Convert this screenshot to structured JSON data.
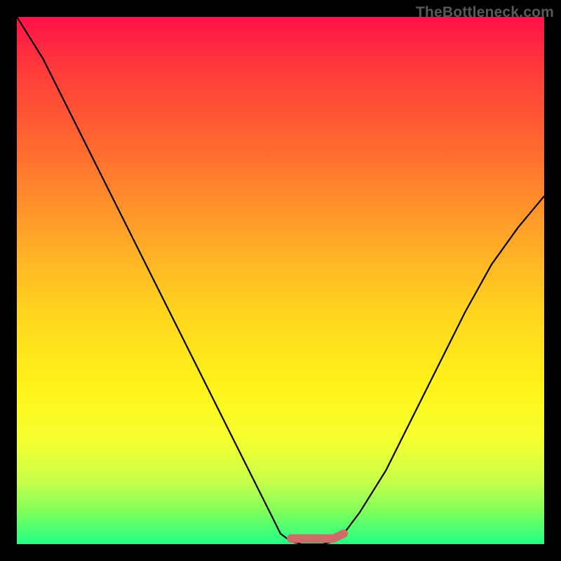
{
  "watermark": "TheBottleneck.com",
  "chart_data": {
    "type": "line",
    "title": "",
    "xlabel": "",
    "ylabel": "",
    "xlim": [
      0,
      100
    ],
    "ylim": [
      0,
      100
    ],
    "grid": false,
    "series": [
      {
        "name": "curve",
        "x": [
          0,
          5,
          10,
          15,
          20,
          25,
          30,
          35,
          40,
          45,
          48,
          50,
          52,
          54,
          56,
          58,
          60,
          62,
          65,
          70,
          75,
          80,
          85,
          90,
          95,
          100
        ],
        "y": [
          100,
          92,
          82,
          72,
          62,
          52,
          42,
          32,
          22,
          12,
          6,
          2,
          0.5,
          0,
          0,
          0,
          0.5,
          2,
          6,
          14,
          24,
          34,
          44,
          53,
          60,
          66
        ]
      }
    ],
    "highlight_segment": {
      "series": "curve",
      "x_from": 52,
      "x_to": 62,
      "color": "#cf6b69"
    }
  }
}
